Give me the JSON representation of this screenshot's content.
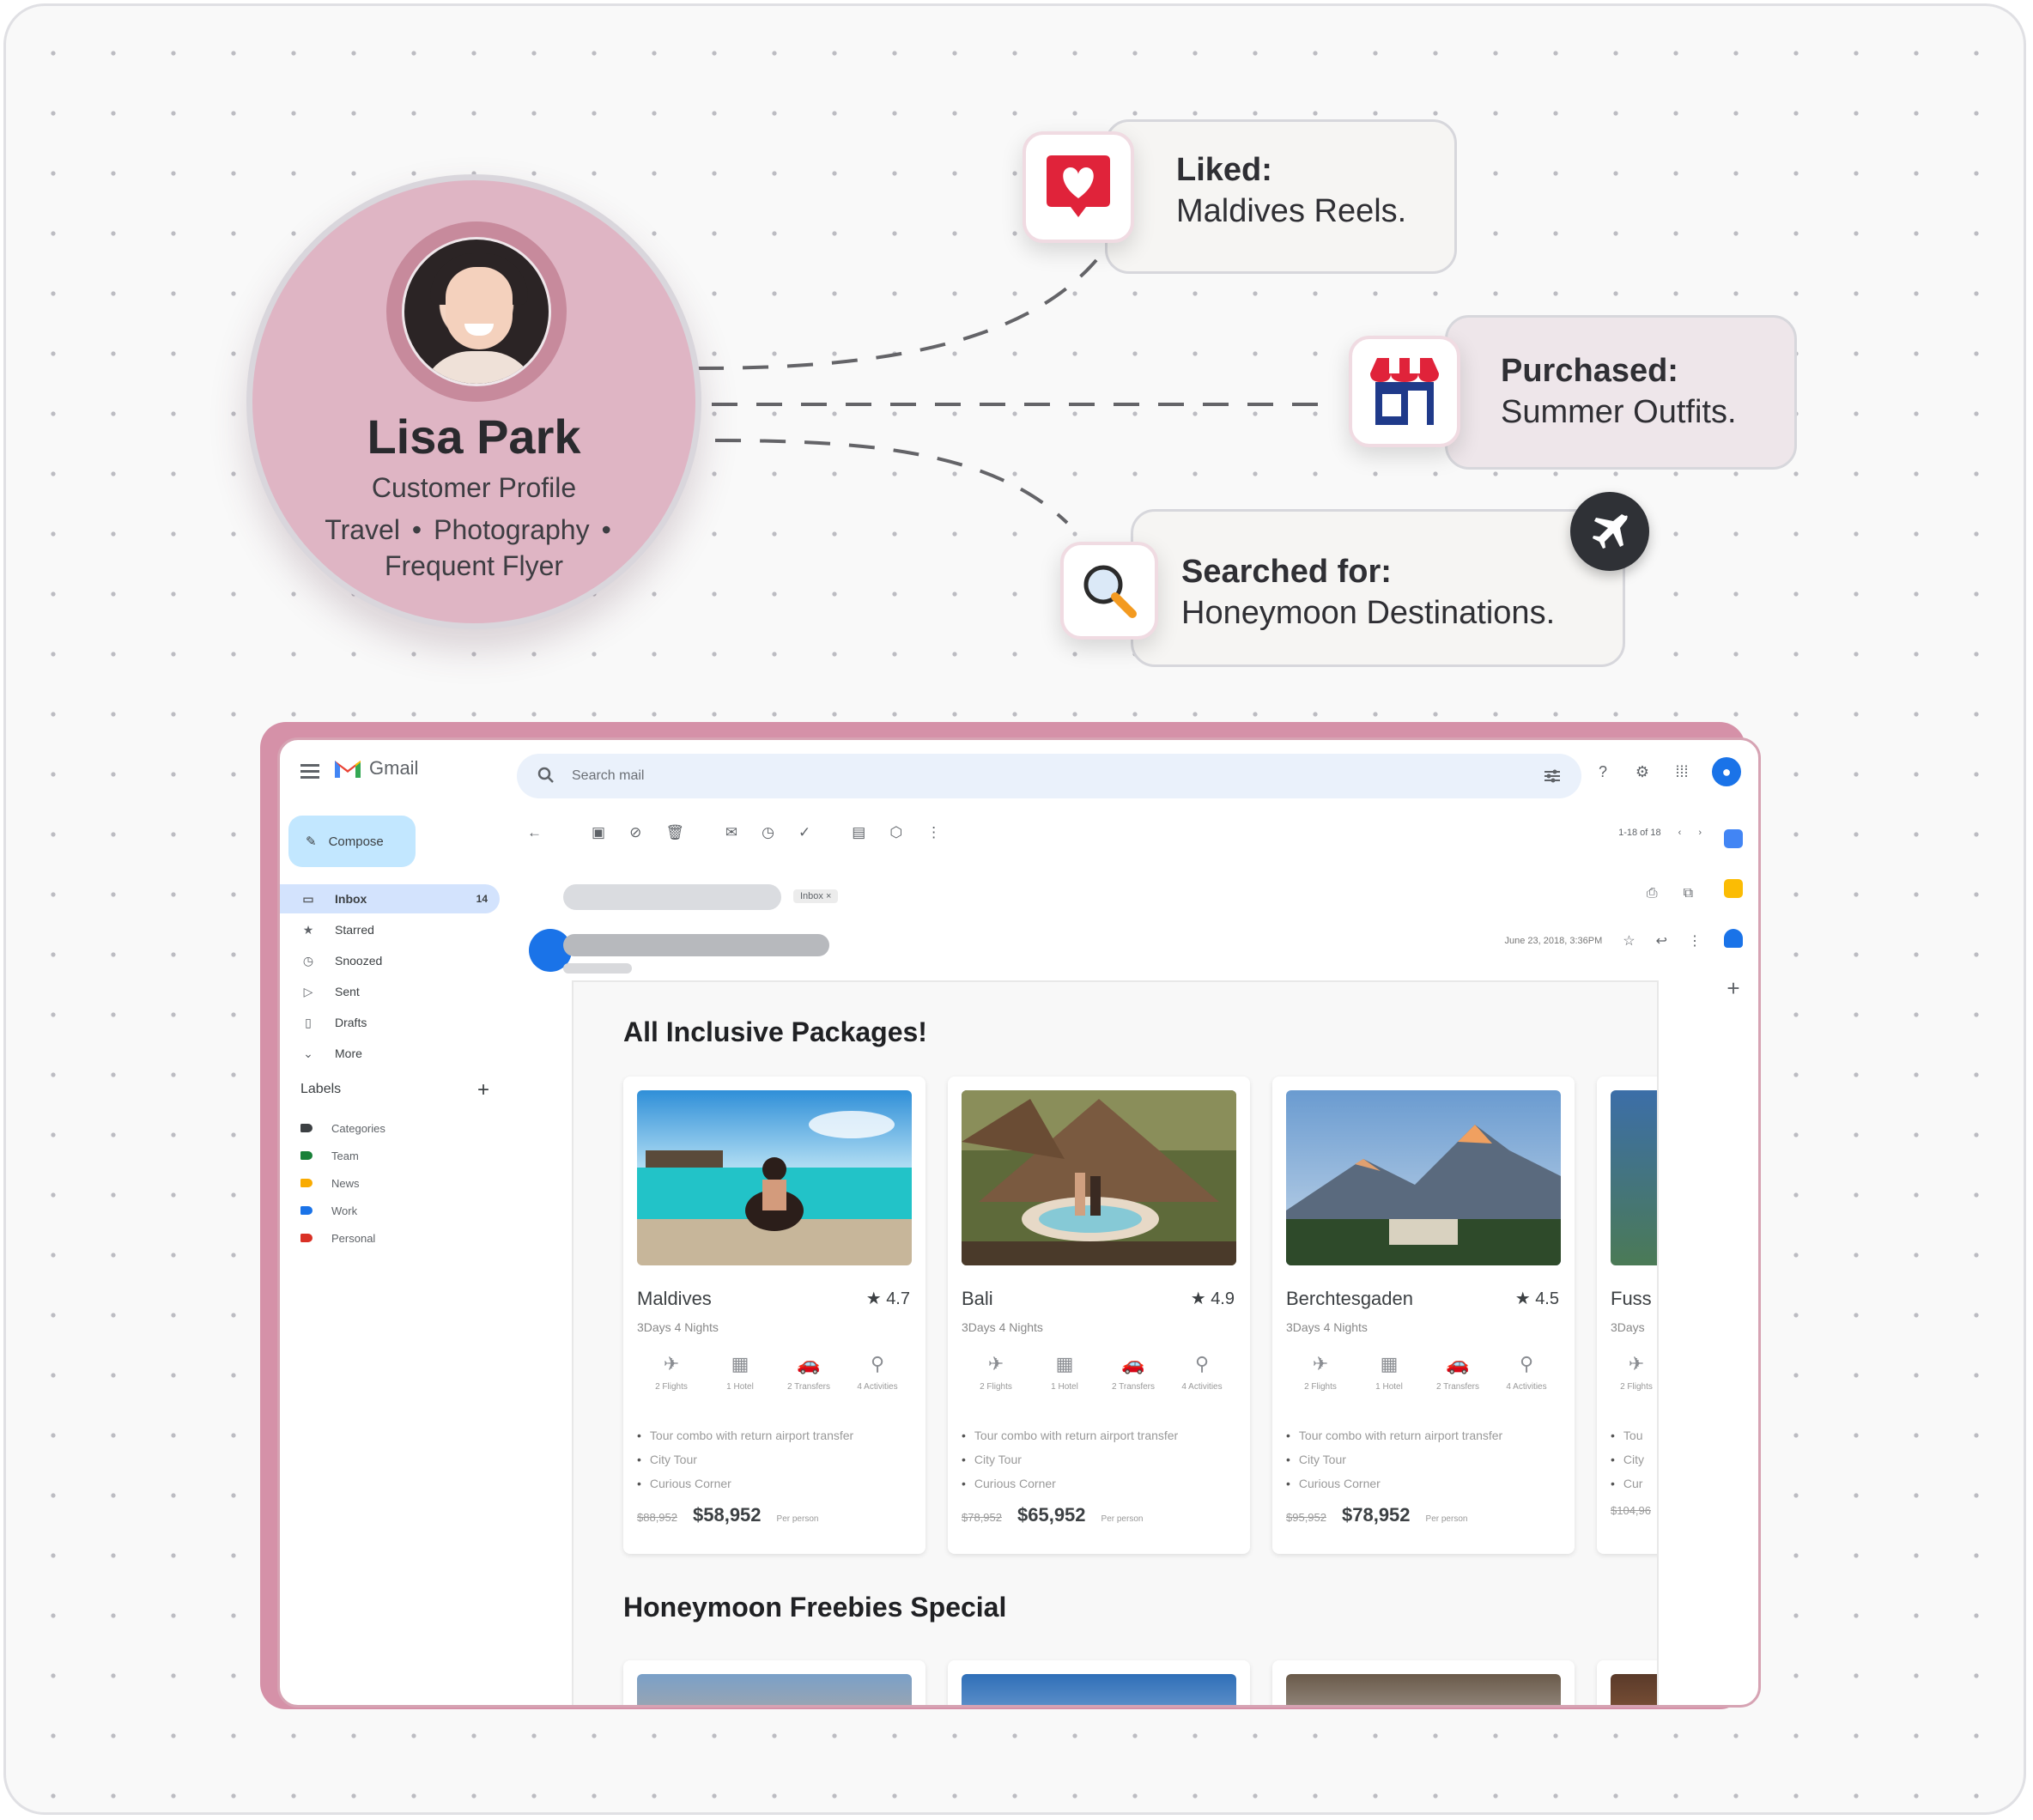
{
  "profile": {
    "name": "Lisa Park",
    "subtitle": "Customer Profile",
    "tags": [
      "Travel",
      "Photography",
      "Frequent Flyer"
    ],
    "separator": "•"
  },
  "activities": {
    "liked": {
      "label": "Liked:",
      "value": "Maldives Reels.",
      "icon": "heart-icon",
      "color": "#e0233a"
    },
    "purchased": {
      "label": "Purchased:",
      "value": "Summer Outfits.",
      "icon": "storefront-icon",
      "color": "#1f3a8a"
    },
    "searched": {
      "label": "Searched for:",
      "value": "Honeymoon Destinations.",
      "icon": "magnifier-icon",
      "badge_icon": "airplane-icon"
    }
  },
  "gmail": {
    "app_name": "Gmail",
    "search_placeholder": "Search mail",
    "compose_label": "Compose",
    "nav": [
      {
        "label": "Inbox",
        "count": "14",
        "icon": "inbox-icon"
      },
      {
        "label": "Starred",
        "icon": "star-icon"
      },
      {
        "label": "Snoozed",
        "icon": "clock-icon"
      },
      {
        "label": "Sent",
        "icon": "send-icon"
      },
      {
        "label": "Drafts",
        "icon": "draft-icon"
      },
      {
        "label": "More",
        "icon": "chevron-down-icon"
      }
    ],
    "labels_heading": "Labels",
    "labels": [
      {
        "name": "Categories",
        "color": "#3c4043"
      },
      {
        "name": "Team",
        "color": "#188038"
      },
      {
        "name": "News",
        "color": "#f9ab00"
      },
      {
        "name": "Work",
        "color": "#1a73e8"
      },
      {
        "name": "Personal",
        "color": "#d93025"
      }
    ],
    "pager": "1-18 of 18",
    "inbox_chip": "Inbox ×",
    "message_date": "June 23, 2018, 3:36PM",
    "sections": {
      "packages_title": "All Inclusive Packages!",
      "freebies_title": "Honeymoon Freebies Special"
    },
    "amenity_labels": [
      "2 Flights",
      "1 Hotel",
      "2 Transfers",
      "4 Activities"
    ],
    "bullets": [
      "Tour combo with return airport transfer",
      "City Tour",
      "Curious Corner"
    ],
    "per_person": "Per person",
    "packages": [
      {
        "name": "Maldives",
        "rating": "4.7",
        "duration": "3Days 4 Nights",
        "old_price": "$88,952",
        "price": "$58,952"
      },
      {
        "name": "Bali",
        "rating": "4.9",
        "duration": "3Days 4 Nights",
        "old_price": "$78,952",
        "price": "$65,952"
      },
      {
        "name": "Berchtesgaden",
        "rating": "4.5",
        "duration": "3Days 4 Nights",
        "old_price": "$95,952",
        "price": "$78,952"
      },
      {
        "name": "Fuss",
        "duration": "3Days",
        "old_price": "$104,96"
      }
    ],
    "fourth_bullets": [
      "Tou",
      "City",
      "Cur"
    ],
    "fourth_amenity": "2 Flights"
  }
}
